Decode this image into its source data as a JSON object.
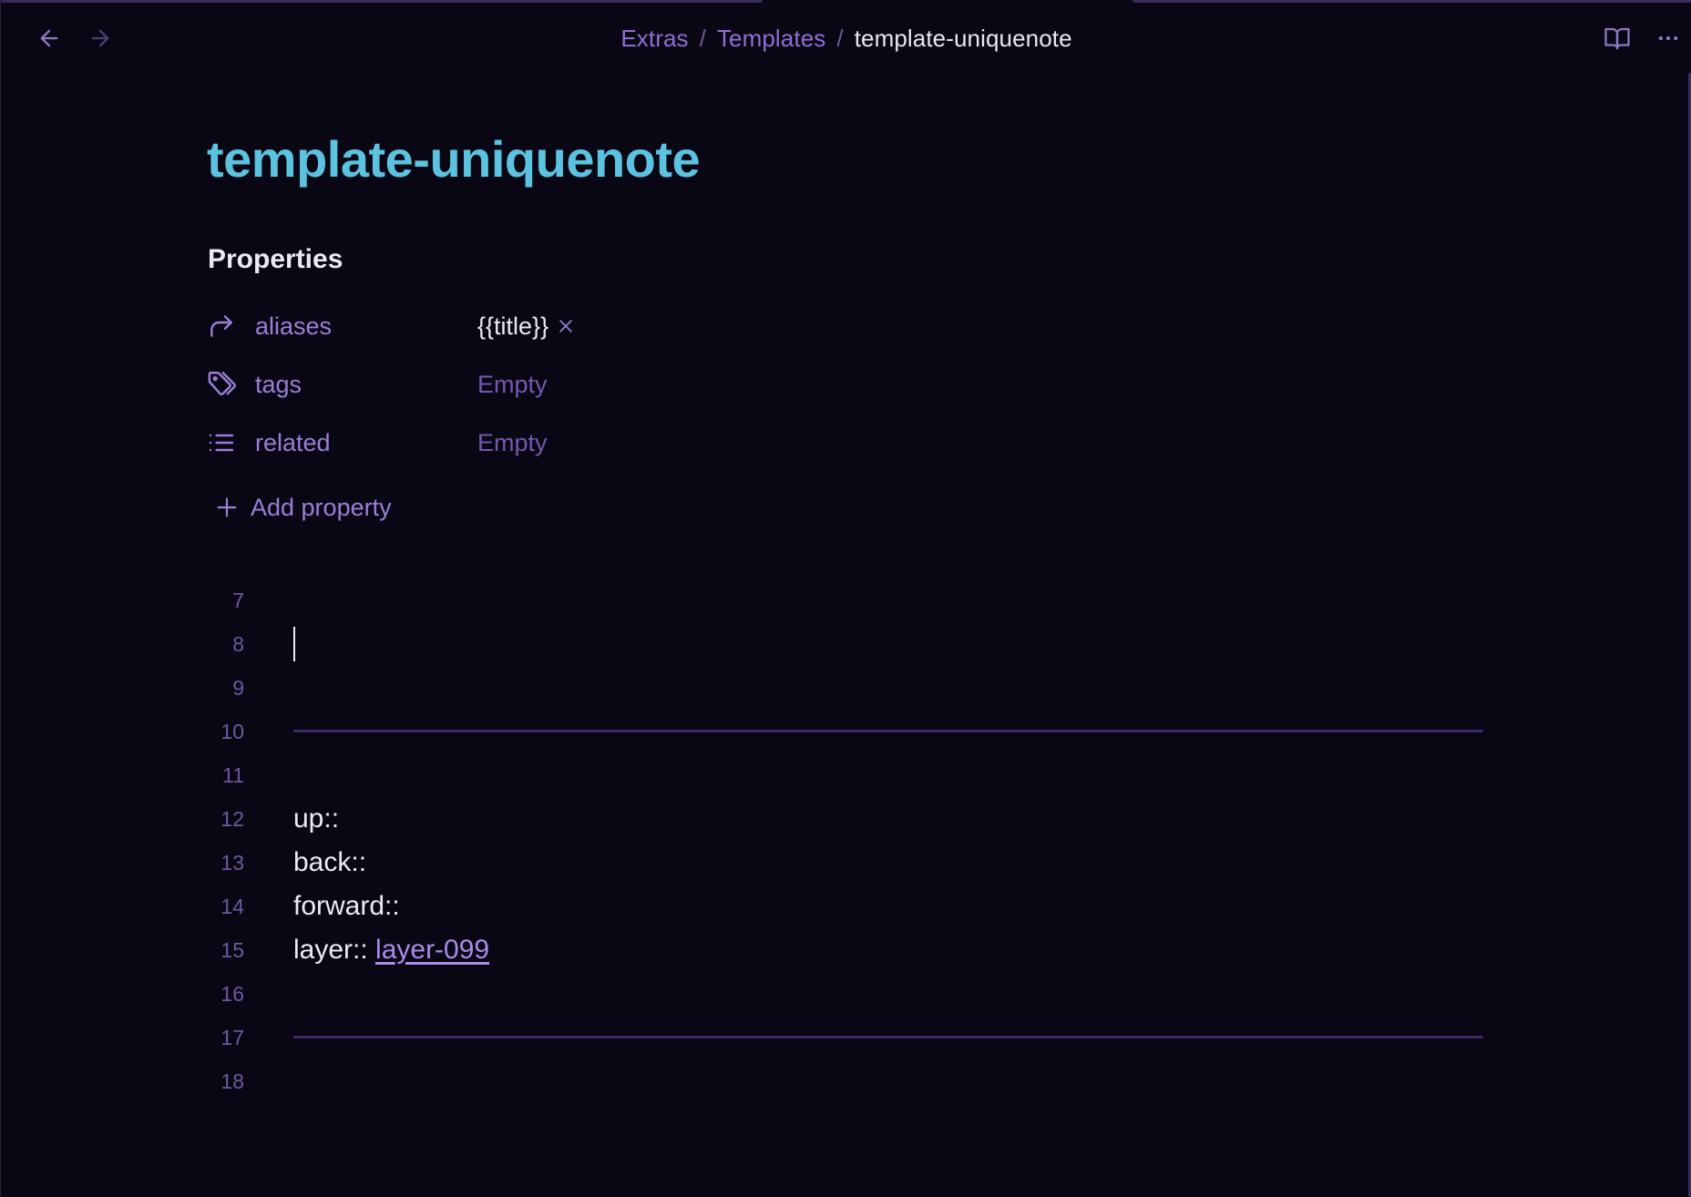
{
  "breadcrumb": {
    "items": [
      "Extras",
      "Templates"
    ],
    "current": "template-uniquenote",
    "separator": "/"
  },
  "header": {
    "back_icon": "arrow-left-icon",
    "forward_icon": "arrow-right-icon",
    "reading_view_icon": "book-open-icon",
    "more_icon": "more-horizontal-icon"
  },
  "document": {
    "title": "template-uniquenote"
  },
  "properties": {
    "heading": "Properties",
    "rows": [
      {
        "key": "aliases",
        "icon": "forward-arrow-icon",
        "value": "{{title}}",
        "empty": false
      },
      {
        "key": "tags",
        "icon": "tags-icon",
        "value": "Empty",
        "empty": true
      },
      {
        "key": "related",
        "icon": "list-icon",
        "value": "Empty",
        "empty": true
      }
    ],
    "add_label": "Add property"
  },
  "editor": {
    "lines": [
      {
        "num": "7",
        "text": ""
      },
      {
        "num": "8",
        "text": ""
      },
      {
        "num": "9",
        "text": ""
      },
      {
        "num": "10",
        "text": ""
      },
      {
        "num": "11",
        "text": ""
      },
      {
        "num": "12",
        "text": "up::"
      },
      {
        "num": "13",
        "text": "back::"
      },
      {
        "num": "14",
        "text": "forward::"
      },
      {
        "num": "15",
        "text": "layer:: ",
        "link": "layer-099"
      },
      {
        "num": "16",
        "text": ""
      },
      {
        "num": "17",
        "text": ""
      },
      {
        "num": "18",
        "text": ""
      }
    ]
  },
  "colors": {
    "background": "#0a0715",
    "title": "#5bc3df",
    "accent": "#9a7fd6",
    "link": "#a98be8",
    "rule": "#3f2a6b"
  }
}
